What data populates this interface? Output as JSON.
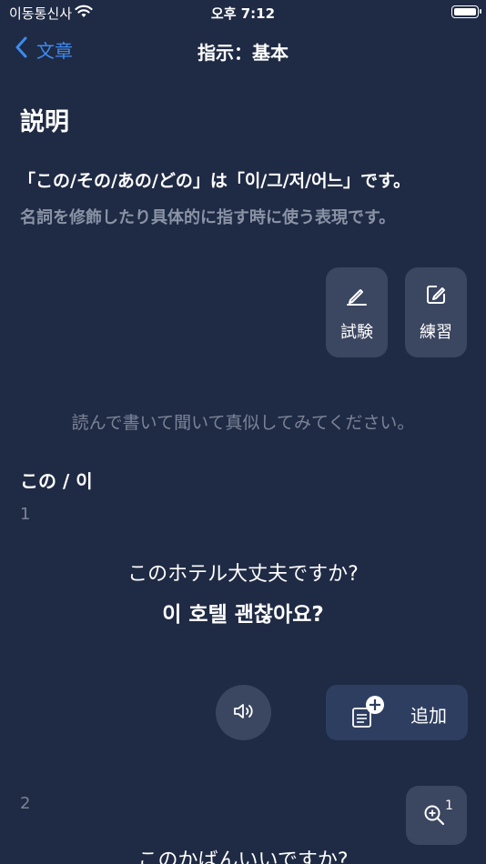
{
  "status": {
    "carrier": "이동통신사",
    "time": "오후 7:12"
  },
  "nav": {
    "back_label": "文章",
    "title": "指示：基本"
  },
  "explanation": {
    "heading": "説明",
    "line1": "「この/その/あの/どの」は「이/그/저/어느」です。",
    "line2": "名詞を修飾したり具体的に指す時に使う表現です。"
  },
  "actions": {
    "test_label": "試験",
    "practice_label": "練習"
  },
  "instruction": "読んで書いて聞いて真似してみてください。",
  "group": {
    "title": "この / 이"
  },
  "sentences": [
    {
      "index": "1",
      "jp": "このホテル大丈夫ですか?",
      "ko": "이 호텔 괜찮아요?"
    },
    {
      "index": "2",
      "jp": "このかばんいいですか?"
    }
  ],
  "controls": {
    "add_label": "追加",
    "zoom_badge": "1"
  },
  "colors": {
    "background": "#1f2a44",
    "accent": "#3d8bf0",
    "button": "#3b4660",
    "add_button": "#2e3e60",
    "muted_text": "#8a93a5"
  },
  "icons": {
    "back": "chevron-left-icon",
    "test": "pencil-icon",
    "practice": "edit-square-icon",
    "sound": "speaker-icon",
    "add": "note-add-icon",
    "zoom": "zoom-in-icon"
  }
}
